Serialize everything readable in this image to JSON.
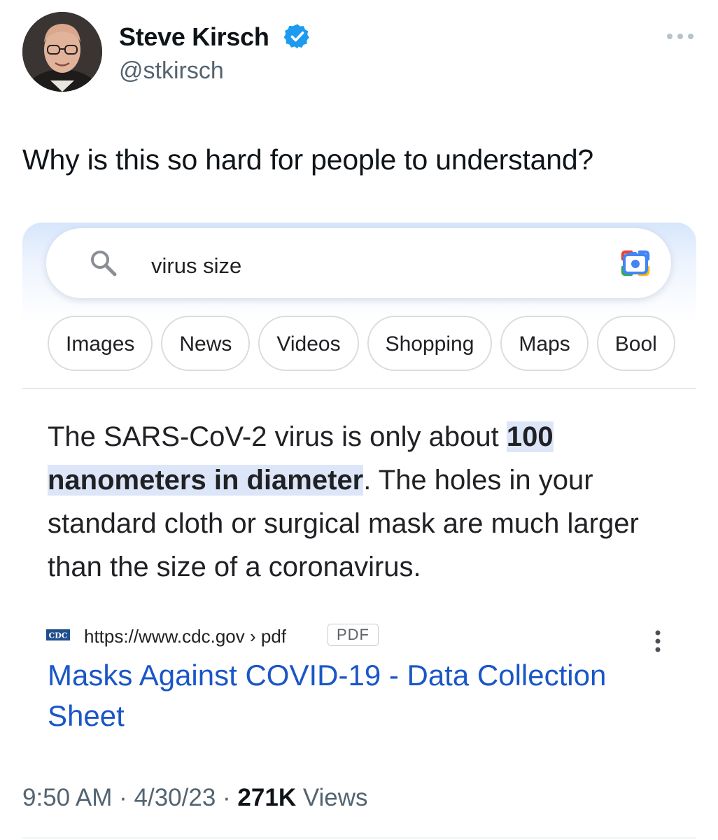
{
  "author": {
    "name": "Steve Kirsch",
    "handle": "@stkirsch",
    "verified_icon": "verified-badge-icon",
    "avatar": "avatar-photo"
  },
  "tweet": {
    "text": "Why is this so hard for people to understand?"
  },
  "screenshot": {
    "search": {
      "query": "virus size",
      "search_icon": "search-icon",
      "lens_icon": "camera-lens-icon"
    },
    "chips": [
      "Images",
      "News",
      "Videos",
      "Shopping",
      "Maps",
      "Bool"
    ],
    "snippet": {
      "before": "The SARS-CoV-2 virus is only about ",
      "highlight_1": "100",
      "highlight_2": "nanometers in diameter",
      "after": ". The holes in your standard cloth or surgical mask are much larger than the size of a coronavirus."
    },
    "result": {
      "favicon_text": "CDC",
      "url": "https://www.cdc.gov › pdf",
      "badge": "PDF",
      "title": "Masks Against COVID-19 - Data Collection Sheet"
    }
  },
  "meta": {
    "time": "9:50 AM",
    "sep1": " · ",
    "date": "4/30/23",
    "sep2": " · ",
    "views_count": "271K",
    "views_label": " Views"
  },
  "colors": {
    "link_blue": "#1a56c7",
    "verified_blue": "#1d9bf0",
    "meta_gray": "#536471"
  }
}
